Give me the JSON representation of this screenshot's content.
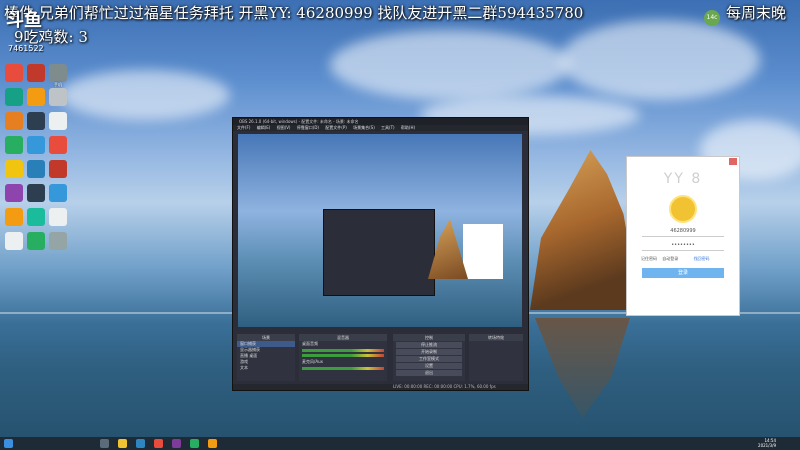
{
  "overlay": {
    "line1": "棒件 兄弟们帮忙过过福星任务拜托  开黑YY: 46280999  找队友进开黑二群594435780",
    "line1_right": "每周末晚",
    "line2": "9吃鸡数: 3",
    "logo": "斗鱼",
    "room": "7461522",
    "badge": "14c"
  },
  "desktop_icons": [
    {
      "label": "",
      "color": "#e74c3c",
      "icon": "game-icon"
    },
    {
      "label": "",
      "color": "#c0392b",
      "icon": "avatar-icon"
    },
    {
      "label": "手机",
      "color": "#7f8c8d",
      "icon": "phone-icon"
    },
    {
      "label": "",
      "color": "#16a085",
      "icon": "app-icon"
    },
    {
      "label": "",
      "color": "#f39c12",
      "icon": "chrome-icon"
    },
    {
      "label": "",
      "color": "#bdc3c7",
      "icon": "file-icon"
    },
    {
      "label": "",
      "color": "#e67e22",
      "icon": "app-icon"
    },
    {
      "label": "",
      "color": "#2c3e50",
      "icon": "qq-icon"
    },
    {
      "label": "",
      "color": "#ecf0f1",
      "icon": "file-icon"
    },
    {
      "label": "",
      "color": "#27ae60",
      "icon": "app-icon"
    },
    {
      "label": "",
      "color": "#3498db",
      "icon": "folder-icon"
    },
    {
      "label": "",
      "color": "#e74c3c",
      "icon": "app-icon"
    },
    {
      "label": "",
      "color": "#f1c40f",
      "icon": "app-icon"
    },
    {
      "label": "",
      "color": "#2980b9",
      "icon": "app-icon"
    },
    {
      "label": "",
      "color": "#c0392b",
      "icon": "app-icon"
    },
    {
      "label": "",
      "color": "#8e44ad",
      "icon": "app-icon"
    },
    {
      "label": "",
      "color": "#2c3e50",
      "icon": "app-icon"
    },
    {
      "label": "",
      "color": "#3498db",
      "icon": "edge-icon"
    },
    {
      "label": "",
      "color": "#f39c12",
      "icon": "app-icon"
    },
    {
      "label": "",
      "color": "#1abc9c",
      "icon": "app-icon"
    },
    {
      "label": "",
      "color": "#ecf0f1",
      "icon": "file-icon"
    },
    {
      "label": "",
      "color": "#ecf0f1",
      "icon": "file-icon"
    },
    {
      "label": "",
      "color": "#27ae60",
      "icon": "app-icon"
    },
    {
      "label": "",
      "color": "#95a5a6",
      "icon": "app-icon"
    }
  ],
  "obs": {
    "title": "OBS 26.1.0 (64-bit, windows) - 配置文件: 未命名 - 场景: 未命名",
    "menu": [
      "文件(F)",
      "编辑(E)",
      "视图(V)",
      "停靠窗口(D)",
      "配置文件(P)",
      "场景集合(S)",
      "工具(T)",
      "帮助(H)"
    ],
    "docks": {
      "scenes": "场景",
      "sources": "来源",
      "mixer": "混音器",
      "controls": "控制",
      "transitions": "转场特效"
    },
    "scenes": [
      "窗口捕获",
      "显示器捕获",
      "直播 桌面",
      "游戏",
      "文本"
    ],
    "controls": [
      "停止推流",
      "开始录制",
      "工作室模式",
      "设置",
      "退出"
    ],
    "mixer": [
      "桌面音频",
      "麦克风/Aux"
    ],
    "status": "LIVE: 00:00:00  REC: 00:00:00  CPU: 1.7%, 60.00 fps"
  },
  "yy": {
    "title": "YY 8",
    "account": "46280999",
    "password": "••••••••",
    "remember": "记住密码",
    "auto": "自动登录",
    "find": "找回密码",
    "login": "登录"
  },
  "taskbar": {
    "time": "14:54",
    "date": "2021/3/9"
  }
}
